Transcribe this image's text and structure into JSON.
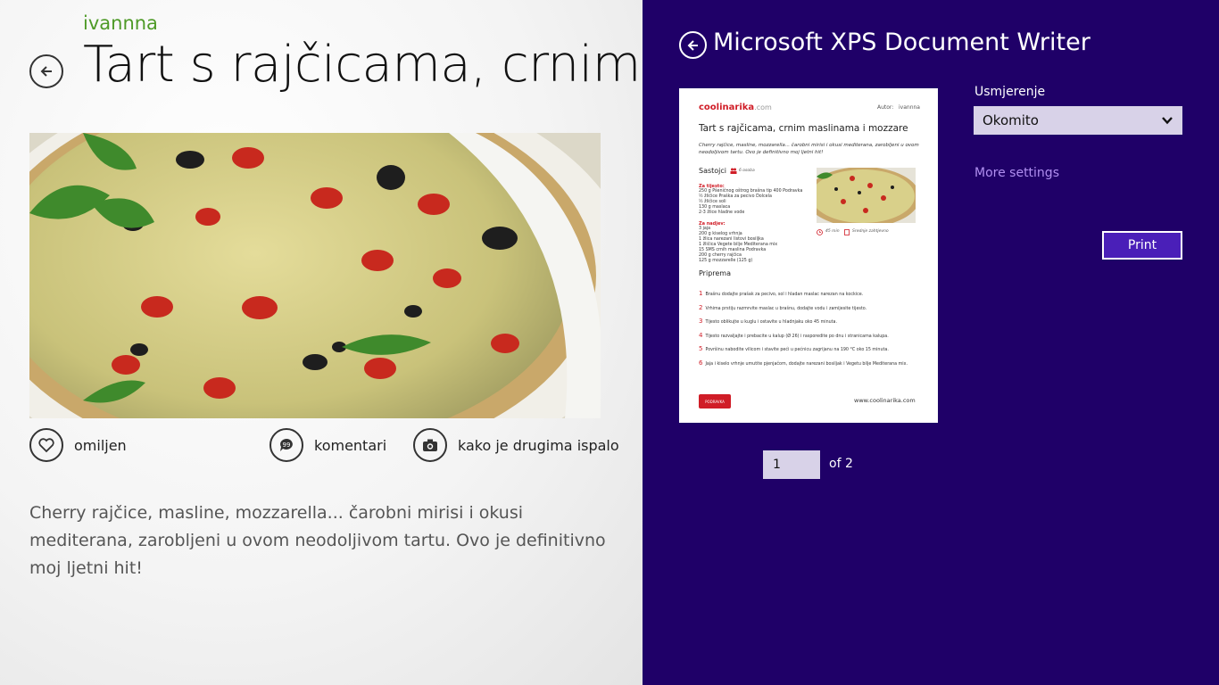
{
  "app": {
    "author": "ivannna",
    "title": "Tart s rajčicama, crnim maslinama i mozzare",
    "actions": {
      "favorite_label": "omiljen",
      "comments_label": "komentari",
      "photos_label": "kako je drugima ispalo"
    },
    "description": "Cherry rajčice, masline, mozzarella... čarobni mirisi i okusi mediterana, zarobljeni u ovom neodoljivom tartu. Ovo je definitivno moj ljetni hit!"
  },
  "print_panel": {
    "printer_name": "Microsoft XPS Document Writer",
    "orientation_label": "Usmjerenje",
    "orientation_value": "Okomito",
    "more_settings": "More settings",
    "print_label": "Print",
    "current_page": "1",
    "page_total": "of 2",
    "preview": {
      "logo": "coolinarika",
      "logo_domain": ".com",
      "author_label": "Autor:",
      "author_name": "ivannna",
      "title": "Tart s rajčicama, crnim maslinama i mozzare",
      "intro": "Cherry rajčice, masline, mozzarella... čarobni mirisi i okusi mediterana, zarobljeni u ovom neodoljivom tartu. Ovo je definitivno moj ljetni hit!",
      "ingredients_heading": "Sastojci",
      "servings": "6 osoba",
      "dough_heading": "Za tijesto:",
      "dough_items": [
        "250 g Pšeničnog oštrog brašna tip 400 Podravka",
        "½ žličice Praška za pecivo Dolcela",
        "½ žličice soli",
        "130 g maslaca",
        "2-3 žlice hladne vode"
      ],
      "filling_heading": "Za nadjev:",
      "filling_items": [
        "3 jaja",
        "200 g kiselog vrhnja",
        "1 žlica narezani listovi bosiljka",
        "1 žličica Vegete bilje Mediterana mix",
        "15 SMS crnih maslina Podravka",
        "200 g cherry rajčica",
        "125 g mozzarelle (125 g)"
      ],
      "time": "45 min",
      "difficulty": "Srednje zahtjevno",
      "prep_heading": "Priprema",
      "steps": [
        {
          "n": "1",
          "text": "Brašnu dodajte prašak za pecivo, sol i hladan maslac narezan na kockice."
        },
        {
          "n": "2",
          "text": "Vrhima prstiju razmrvite maslac u brašnu, dodajte vodu i zamijesite tijesto."
        },
        {
          "n": "3",
          "text": "Tijesto oblikujte u kuglu i ostavite u hladnjaku oko 45 minuta."
        },
        {
          "n": "4",
          "text": "Tijesto razvaljajte i prebacite u kalup (Ø 26) i rasporedite po dnu i stranicama kalupa."
        },
        {
          "n": "5",
          "text": "Površinu nabodite vilicom i stavite peći u pećnicu zagrijanu na 190 °C oko 15 minuta."
        },
        {
          "n": "6",
          "text": "Jaja i kiselo vrhnje umutite pjenjačom, dodajte narezani bosiljak i Vegetu bilje Mediterana mix."
        }
      ],
      "brand": "PODRAVKA",
      "url": "www.coolinarika.com"
    }
  },
  "colors": {
    "panel_bg": "#1f0068",
    "print_button": "#4a1fb8",
    "link": "#b08ff0",
    "author_green": "#4e9a27",
    "brand_red": "#d01d27"
  },
  "icons": [
    "back-arrow-icon",
    "heart-icon",
    "comments-icon",
    "camera-icon",
    "chevron-down-icon",
    "clock-icon",
    "people-icon"
  ]
}
